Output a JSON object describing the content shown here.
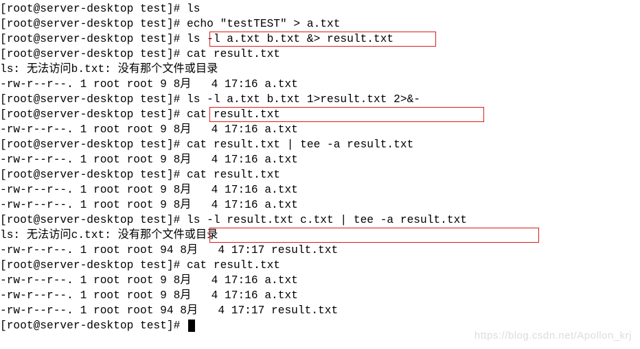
{
  "prompt": "[root@server-desktop test]#",
  "lines": [
    {
      "type": "cmd",
      "text": "ls"
    },
    {
      "type": "cmd",
      "text": "echo \"testTEST\" > a.txt"
    },
    {
      "type": "cmd",
      "text": "ls -l a.txt b.txt &> result.txt",
      "boxed": 1
    },
    {
      "type": "cmd",
      "text": "cat result.txt"
    },
    {
      "type": "out",
      "text": "ls: 无法访问b.txt: 没有那个文件或目录"
    },
    {
      "type": "out",
      "text": "-rw-r--r--. 1 root root 9 8月   4 17:16 a.txt"
    },
    {
      "type": "cmd",
      "text": "ls -l a.txt b.txt 1>result.txt 2>&-",
      "boxed": 2
    },
    {
      "type": "cmd",
      "text": "cat result.txt"
    },
    {
      "type": "out",
      "text": "-rw-r--r--. 1 root root 9 8月   4 17:16 a.txt"
    },
    {
      "type": "cmd",
      "text": "cat result.txt | tee -a result.txt"
    },
    {
      "type": "out",
      "text": "-rw-r--r--. 1 root root 9 8月   4 17:16 a.txt"
    },
    {
      "type": "cmd",
      "text": "cat result.txt"
    },
    {
      "type": "out",
      "text": "-rw-r--r--. 1 root root 9 8月   4 17:16 a.txt"
    },
    {
      "type": "out",
      "text": "-rw-r--r--. 1 root root 9 8月   4 17:16 a.txt"
    },
    {
      "type": "cmd",
      "text": "ls -l result.txt c.txt | tee -a result.txt",
      "boxed": 3
    },
    {
      "type": "out",
      "text": "ls: 无法访问c.txt: 没有那个文件或目录"
    },
    {
      "type": "out",
      "text": "-rw-r--r--. 1 root root 94 8月   4 17:17 result.txt"
    },
    {
      "type": "cmd",
      "text": "cat result.txt"
    },
    {
      "type": "out",
      "text": "-rw-r--r--. 1 root root 9 8月   4 17:16 a.txt"
    },
    {
      "type": "out",
      "text": "-rw-r--r--. 1 root root 9 8月   4 17:16 a.txt"
    },
    {
      "type": "out",
      "text": "-rw-r--r--. 1 root root 94 8月   4 17:17 result.txt"
    },
    {
      "type": "cmd",
      "text": "",
      "cursor": true
    }
  ],
  "watermark": "https://blog.csdn.net/Apollon_krj"
}
